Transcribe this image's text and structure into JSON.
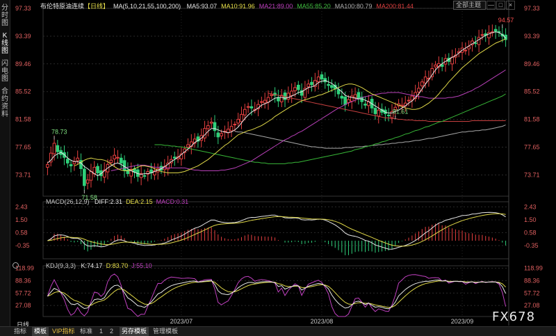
{
  "sidebar": {
    "tabs": [
      "分时图",
      "K线图",
      "闪电图",
      "合约资料"
    ]
  },
  "topbar": {
    "title": "布伦特原油连续",
    "period": "【日线】",
    "ma_label": "MA(5,10,21,55,100,200)",
    "ma_values": [
      {
        "text": "MA5:93.07",
        "color": "#e8e8e8"
      },
      {
        "text": "MA10:91.96",
        "color": "#e8e04a"
      },
      {
        "text": "MA21:89.00",
        "color": "#c040c0"
      },
      {
        "text": "MA55:85.20",
        "color": "#40c040"
      },
      {
        "text": "MA100:80.79",
        "color": "#b0b0b0"
      },
      {
        "text": "MA200:81.44",
        "color": "#e04040"
      }
    ],
    "dropdown": "全部主题",
    "window_buttons": [
      "—",
      "□",
      "×"
    ]
  },
  "colors": {
    "up": "#e84040",
    "down": "#2fd07a",
    "axis_text": "#e06060",
    "grid": "#2a2a2a"
  },
  "chart_data": [
    {
      "type": "candlestick",
      "y_ticks": [
        97.33,
        93.39,
        89.46,
        85.52,
        81.58,
        77.65,
        73.71
      ],
      "ylim": [
        70.7,
        97.33
      ],
      "x_ticks": [
        "2023/07",
        "2023/08",
        "2023/09"
      ],
      "annotations": [
        {
          "text": "78.73",
          "index": 2,
          "value": 78.73
        },
        {
          "text": "71.58",
          "index": 11,
          "value": 71.58
        },
        {
          "text": "81.61",
          "index": 104,
          "value": 81.61
        },
        {
          "text": "94.57",
          "index": 136,
          "value": 94.57
        }
      ],
      "closes": [
        75.2,
        76.8,
        78.2,
        77.0,
        76.6,
        76.2,
        75.4,
        75.0,
        75.6,
        76.1,
        74.6,
        72.2,
        73.0,
        74.2,
        74.8,
        74.0,
        73.6,
        74.4,
        75.2,
        75.8,
        76.5,
        76.2,
        75.4,
        74.4,
        73.9,
        74.5,
        74.1,
        73.5,
        73.9,
        73.6,
        74.2,
        74.0,
        74.3,
        74.6,
        74.4,
        74.9,
        75.4,
        75.9,
        76.1,
        76.3,
        76.7,
        77.4,
        78.0,
        78.4,
        78.8,
        78.5,
        79.3,
        80.3,
        80.7,
        81.2,
        80.0,
        79.1,
        79.6,
        79.9,
        80.2,
        80.6,
        80.9,
        81.6,
        82.3,
        83.0,
        83.4,
        83.2,
        83.0,
        83.7,
        84.1,
        84.3,
        84.7,
        85.1,
        85.0,
        84.2,
        85.0,
        84.4,
        85.3,
        85.6,
        86.1,
        85.8,
        85.0,
        86.0,
        86.6,
        86.5,
        87.1,
        87.6,
        87.3,
        86.9,
        86.4,
        86.1,
        85.9,
        85.2,
        84.6,
        83.7,
        84.4,
        84.9,
        85.1,
        84.6,
        84.1,
        83.6,
        84.1,
        83.2,
        82.4,
        82.9,
        82.6,
        82.4,
        82.1,
        82.7,
        83.3,
        83.8,
        83.6,
        83.9,
        84.3,
        84.9,
        85.4,
        86.0,
        86.9,
        87.6,
        87.4,
        88.8,
        89.3,
        89.5,
        89.1,
        90.2,
        89.8,
        90.4,
        90.7,
        91.2,
        91.7,
        91.4,
        91.9,
        92.7,
        92.4,
        93.2,
        93.6,
        93.5,
        93.9,
        94.0,
        94.1,
        94.0,
        93.4,
        92.9
      ],
      "ma5": [
        75.4,
        75.8,
        76.4,
        76.7,
        76.9,
        76.6,
        76.1,
        75.8,
        75.6,
        75.6,
        75.4,
        74.9,
        74.6,
        74.2,
        73.9,
        73.6,
        73.9,
        74.3,
        74.7,
        75.0,
        75.3,
        75.4,
        75.2,
        74.9,
        74.6,
        74.3,
        74.1,
        73.9,
        73.8,
        73.9,
        73.9,
        74.0,
        74.2,
        74.4,
        74.6,
        74.9,
        75.2,
        75.6,
        75.9,
        76.2,
        76.6,
        77.0,
        77.4,
        77.8,
        78.3,
        78.6,
        78.9,
        79.4,
        79.9,
        80.3,
        80.3,
        80.1,
        79.9,
        79.8,
        79.7,
        79.8,
        80.1,
        80.5,
        81.1,
        81.7,
        82.2,
        82.6,
        82.9,
        83.2,
        83.6,
        83.8,
        84.0,
        84.3,
        84.6,
        84.7,
        84.7,
        84.6,
        84.7,
        84.9,
        85.1,
        85.4,
        85.5,
        85.8,
        86.1,
        86.2,
        86.4,
        86.8,
        87.0,
        87.1,
        86.9,
        86.7,
        86.3,
        85.9,
        85.5,
        85.0,
        84.8,
        84.7,
        84.6,
        84.5,
        84.5,
        84.3,
        84.1,
        83.8,
        83.5,
        83.2,
        82.9,
        82.6,
        82.5,
        82.5,
        82.7,
        82.9,
        83.2,
        83.5,
        83.9,
        84.2,
        84.7,
        85.2,
        85.9,
        86.6,
        87.2,
        87.9,
        88.6,
        89.1,
        89.5,
        89.8,
        90.1,
        90.4,
        90.6,
        91.0,
        91.4,
        91.7,
        92.0,
        92.3,
        92.6,
        92.9,
        93.2,
        93.5,
        93.7,
        93.9,
        94.0,
        93.9,
        93.6,
        93.1
      ],
      "ma10": [
        75.0,
        75.2,
        75.5,
        75.8,
        76.0,
        76.1,
        76.0,
        75.9,
        75.9,
        75.8,
        75.6,
        75.2,
        74.9,
        74.6,
        74.4,
        74.3,
        74.3,
        74.4,
        74.6,
        74.8,
        75.0,
        75.0,
        74.9,
        74.8,
        74.6,
        74.4,
        74.2,
        74.1,
        74.0,
        74.0,
        74.0,
        74.0,
        74.1,
        74.2,
        74.4,
        74.6,
        74.8,
        75.0,
        75.3,
        75.6,
        75.9,
        76.3,
        76.7,
        77.1,
        77.5,
        77.9,
        78.2,
        78.6,
        79.0,
        79.4,
        79.6,
        79.8,
        80.0,
        80.1,
        80.3,
        80.5,
        80.7,
        81.0,
        81.3,
        81.6,
        82.0,
        82.3,
        82.6,
        82.9,
        83.2,
        83.5,
        83.7,
        84.0,
        84.2,
        84.4,
        84.5,
        84.7,
        84.8,
        85.0,
        85.1,
        85.3,
        85.5,
        85.7,
        85.9,
        86.1,
        86.3,
        86.5,
        86.6,
        86.6,
        86.5,
        86.3,
        86.1,
        85.8,
        85.5,
        85.2,
        85.0,
        84.8,
        84.6,
        84.4,
        84.2,
        84.0,
        83.8,
        83.6,
        83.4,
        83.2,
        83.1,
        83.0,
        83.0,
        83.1,
        83.3,
        83.6,
        83.9,
        84.3,
        84.7,
        85.2,
        85.8,
        86.3,
        86.9,
        87.4,
        87.9,
        88.4,
        88.9,
        89.3,
        89.7,
        90.1,
        90.5,
        90.9,
        91.2,
        91.5,
        91.8,
        92.1,
        92.4,
        92.6,
        92.8,
        93.0
      ],
      "ma21": [
        74.3,
        74.4,
        74.5,
        74.6,
        74.7,
        74.8,
        74.9,
        75.0,
        75.1,
        75.1,
        75.1,
        75.0,
        74.9,
        74.8,
        74.8,
        74.7,
        74.7,
        74.7,
        74.7,
        74.7,
        74.7,
        74.7,
        74.7,
        74.6,
        74.5,
        74.4,
        74.4,
        74.3,
        74.3,
        74.3,
        74.3,
        74.3,
        74.3,
        74.4,
        74.4,
        74.5,
        74.6,
        74.7,
        74.9,
        75.1,
        75.3,
        75.5,
        75.7,
        76.0,
        76.3,
        76.6,
        76.9,
        77.2,
        77.5,
        77.8,
        78.1,
        78.4,
        78.7,
        78.9,
        79.2,
        79.4,
        79.7,
        79.9,
        80.2,
        80.5,
        80.8,
        81.1,
        81.4,
        81.7,
        82.0,
        82.3,
        82.6,
        82.9,
        83.2,
        83.4,
        83.7,
        83.9,
        84.1,
        84.3,
        84.5,
        84.7,
        84.8,
        84.9,
        85.0,
        85.1,
        85.2,
        85.3,
        85.3,
        85.4,
        85.4,
        85.4,
        85.4,
        85.3,
        85.2,
        85.1,
        85.0,
        84.9,
        84.8,
        84.8,
        84.7,
        84.6,
        84.6,
        84.6,
        84.6,
        84.6,
        84.6,
        84.7,
        84.7,
        84.8,
        84.9,
        85.1,
        85.3,
        85.5,
        85.7,
        86.0,
        86.2,
        86.5,
        86.8,
        87.1,
        87.4,
        87.7,
        88.0,
        88.3,
        88.6
      ],
      "ma55": [
        78.0,
        78.0,
        78.0,
        77.9,
        77.9,
        77.8,
        77.8,
        77.7,
        77.7,
        77.6,
        77.5,
        77.4,
        77.3,
        77.2,
        77.1,
        77.0,
        76.9,
        76.8,
        76.7,
        76.6,
        76.5,
        76.4,
        76.3,
        76.2,
        76.1,
        76.0,
        75.9,
        75.8,
        75.7,
        75.6,
        75.5,
        75.5,
        75.4,
        75.4,
        75.3,
        75.3,
        75.3,
        75.3,
        75.3,
        75.3,
        75.4,
        75.4,
        75.5,
        75.5,
        75.6,
        75.7,
        75.8,
        75.9,
        76.0,
        76.1,
        76.2,
        76.3,
        76.4,
        76.5,
        76.6,
        76.7,
        76.8,
        76.9,
        77.0,
        77.1,
        77.3,
        77.4,
        77.5,
        77.7,
        77.8,
        77.9,
        78.1,
        78.2,
        78.4,
        78.5,
        78.7,
        78.8,
        79.0,
        79.1,
        79.3,
        79.5,
        79.6,
        79.8,
        80.0,
        80.1,
        80.3,
        80.5,
        80.6,
        80.8,
        81.0,
        81.2,
        81.3,
        81.5,
        81.7,
        81.9,
        82.1,
        82.3,
        82.5,
        82.7,
        82.9,
        83.1,
        83.3,
        83.5,
        83.7,
        83.9,
        84.1,
        84.3,
        84.5,
        84.7,
        84.9,
        85.2
      ],
      "ma100": [
        79.9,
        79.8,
        79.8,
        79.7,
        79.6,
        79.5,
        79.4,
        79.3,
        79.2,
        79.1,
        79.0,
        78.9,
        78.8,
        78.7,
        78.6,
        78.5,
        78.4,
        78.3,
        78.2,
        78.1,
        78.0,
        77.9,
        77.8,
        77.7,
        77.7,
        77.6,
        77.6,
        77.5,
        77.5,
        77.5,
        77.5,
        77.5,
        77.5,
        77.6,
        77.6,
        77.6,
        77.7,
        77.7,
        77.7,
        77.8,
        77.8,
        77.9,
        77.9,
        78.0,
        78.0,
        78.1,
        78.1,
        78.2,
        78.2,
        78.3,
        78.3,
        78.4,
        78.4,
        78.5,
        78.6,
        78.6,
        78.7,
        78.8,
        78.9,
        78.9,
        79.0,
        79.1,
        79.2,
        79.3,
        79.4,
        79.5,
        79.6,
        79.7,
        79.8,
        79.8,
        79.9,
        79.9,
        80.0,
        80.0,
        80.1,
        80.1,
        80.2,
        80.3,
        80.4,
        80.5,
        80.6,
        80.8
      ],
      "ma200": [
        85.3,
        85.2,
        85.1,
        85.0,
        84.9,
        84.8,
        84.7,
        84.6,
        84.5,
        84.4,
        84.3,
        84.2,
        84.1,
        84.0,
        83.9,
        83.8,
        83.7,
        83.6,
        83.5,
        83.4,
        83.3,
        83.2,
        83.1,
        83.0,
        82.9,
        82.8,
        82.7,
        82.6,
        82.5,
        82.4,
        82.3,
        82.2,
        82.1,
        82.0,
        81.9,
        81.8,
        81.8,
        81.7,
        81.7,
        81.6,
        81.6,
        81.5,
        81.5,
        81.5,
        81.4,
        81.4,
        81.4,
        81.4,
        81.3,
        81.3,
        81.3,
        81.3,
        81.3,
        81.3,
        81.3,
        81.3,
        81.3,
        81.3,
        81.3,
        81.3,
        81.3,
        81.4,
        81.4,
        81.4,
        81.4,
        81.4,
        81.4,
        81.4,
        81.4,
        81.4,
        81.4,
        81.4
      ]
    },
    {
      "type": "macd",
      "title": "MACD(26,12,9)",
      "labels": [
        {
          "text": "DIFF:2.31",
          "color": "#e8e8e8"
        },
        {
          "text": "DEA:2.15",
          "color": "#e8e04a"
        },
        {
          "text": "MACD:0.31",
          "color": "#c040c0"
        }
      ],
      "y_ticks": [
        2.43,
        1.5,
        0.58,
        -0.35
      ],
      "ylim": [
        -1.3,
        2.8
      ]
    },
    {
      "type": "kdj",
      "title": "KDJ(9,3,3)",
      "labels": [
        {
          "text": "K:74.17",
          "color": "#e8e8e8"
        },
        {
          "text": "D:83.70",
          "color": "#e8e04a"
        },
        {
          "text": "J:55.10",
          "color": "#c040c0"
        }
      ],
      "y_ticks": [
        118.99,
        88.36,
        57.72,
        27.08
      ],
      "ylim": [
        0,
        125
      ]
    }
  ],
  "bottombar": {
    "period_label": "日线",
    "tabs": [
      "指标",
      "模板",
      "VIP指标",
      "标准",
      "1",
      "2",
      "另存模板",
      "管理模板"
    ],
    "selected": [
      1,
      6
    ]
  },
  "watermark": "FX678"
}
